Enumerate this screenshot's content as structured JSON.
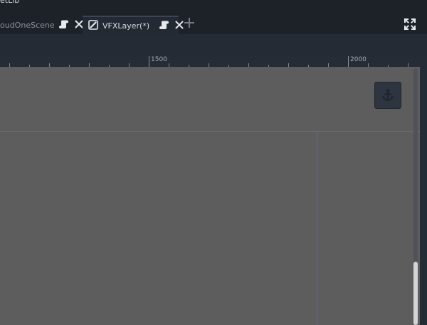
{
  "window": {
    "title_fragment": "etLib"
  },
  "tabs": [
    {
      "label": "oudOneScene",
      "active": false,
      "icons": [
        "script-icon",
        "close-icon"
      ]
    },
    {
      "label": "VFXLayer(*)",
      "active": true,
      "icons": [
        "scene-edit-icon",
        "script-icon",
        "close-icon"
      ]
    }
  ],
  "tabbar": {
    "add_tab_icon": "plus-icon",
    "fullscreen_icon": "fullscreen-icon"
  },
  "ruler": {
    "labels": [
      "1500",
      "2000"
    ]
  },
  "viewport": {
    "anchor_icon": "anchor-icon",
    "background_color": "#5d5d5d",
    "x_axis_color": "#c24a6b",
    "guide_color": "#6c5fa6"
  }
}
